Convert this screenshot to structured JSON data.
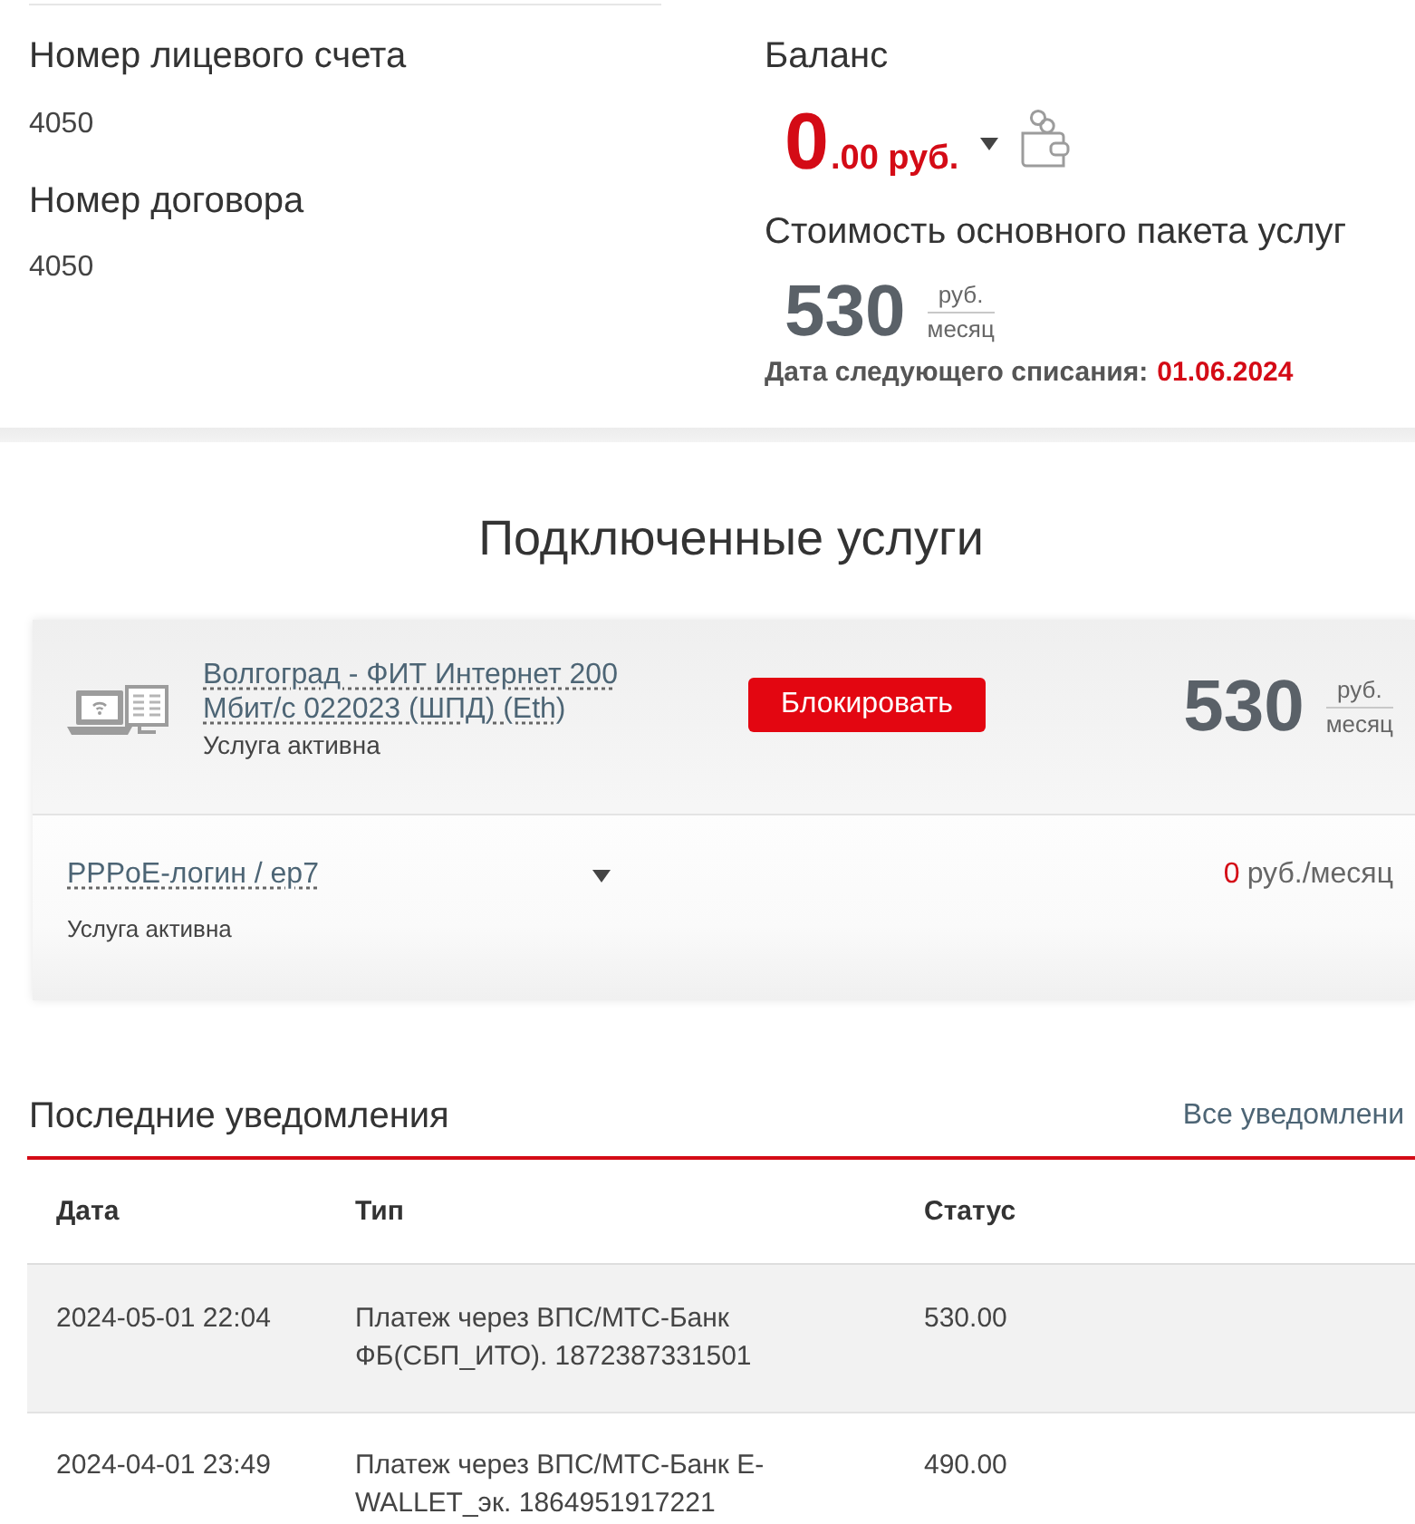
{
  "account": {
    "label": "Номер лицевого счета",
    "value": "4050"
  },
  "contract": {
    "label": "Номер договора",
    "value": "4050"
  },
  "balance": {
    "label": "Баланс",
    "integer": "0",
    "fraction": ".00 руб."
  },
  "package": {
    "label": "Стоимость основного пакета услуг",
    "price": "530",
    "unit_top": "руб.",
    "unit_bottom": "месяц",
    "next_charge_label": "Дата следующего списания:",
    "next_charge_date": "01.06.2024"
  },
  "services": {
    "title": "Подключенные услуги",
    "items": [
      {
        "kind": "tariff",
        "name": "Волгоград - ФИТ Интернет 200 Мбит/с 022023 (ШПД) (Eth)",
        "status": "Услуга активна",
        "button": "Блокировать",
        "price": "530",
        "unit_top": "руб.",
        "unit_bottom": "месяц"
      },
      {
        "kind": "option",
        "name": "PPPoE-логин / ep7",
        "status": "Услуга активна",
        "price": "0",
        "price_unit": "руб./месяц"
      }
    ]
  },
  "notifications": {
    "title": "Последние уведомления",
    "all_link": "Все уведомлени",
    "columns": [
      "Дата",
      "Тип",
      "Статус"
    ],
    "rows": [
      {
        "cells": [
          "2024-05-01 22:04",
          "Платеж через ВПС/МТС-Банк ФБ(СБП_ИТО). 1872387331501",
          "530.00"
        ]
      },
      {
        "cells": [
          "2024-04-01 23:49",
          "Платеж через ВПС/МТС-Банк E-WALLET_эк. 1864951917221",
          "490.00"
        ]
      }
    ]
  }
}
